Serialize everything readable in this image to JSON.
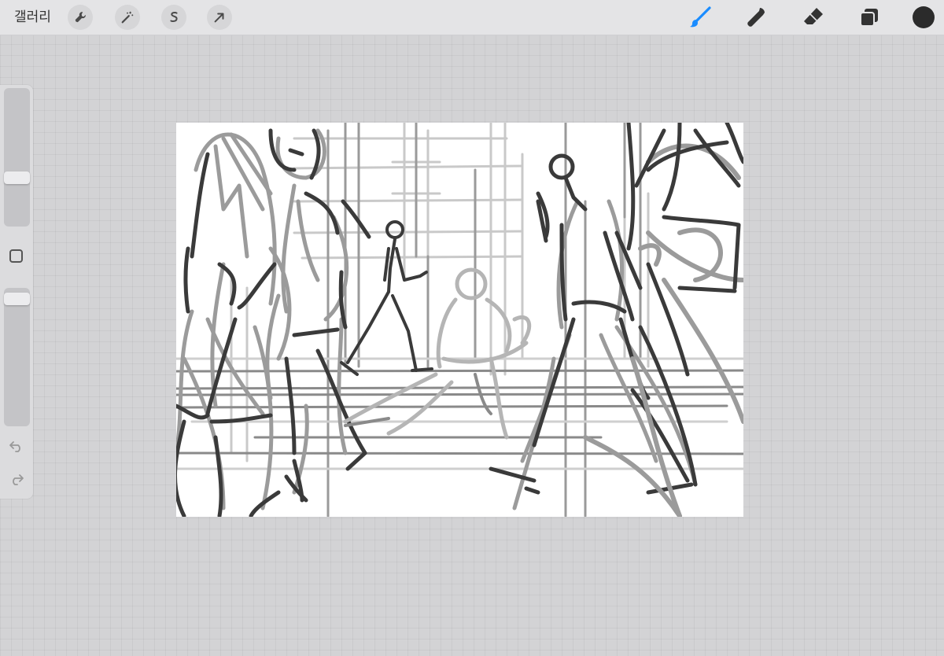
{
  "toolbar": {
    "gallery_label": "갤러리",
    "left_tools": [
      {
        "name": "actions",
        "icon": "wrench-icon"
      },
      {
        "name": "adjustments",
        "icon": "magic-wand-icon"
      },
      {
        "name": "selection",
        "icon": "selection-s-icon"
      },
      {
        "name": "transform",
        "icon": "arrow-cursor-icon"
      }
    ],
    "right_tools": [
      {
        "name": "brush",
        "icon": "brush-icon",
        "active": true
      },
      {
        "name": "smudge",
        "icon": "smudge-finger-icon",
        "active": false
      },
      {
        "name": "eraser",
        "icon": "eraser-icon",
        "active": false
      },
      {
        "name": "layers",
        "icon": "layers-icon",
        "active": false
      }
    ],
    "current_color": "#2b2b2b"
  },
  "sidebar": {
    "brush_size_level": 0.34,
    "opacity_level": 0.96,
    "modify_icon": "square-icon",
    "undo_icon": "undo-icon",
    "redo_icon": "redo-icon"
  },
  "colors": {
    "accent": "#1a8cff",
    "toolbar_bg": "#e4e4e6",
    "canvas_bg": "#ffffff"
  }
}
